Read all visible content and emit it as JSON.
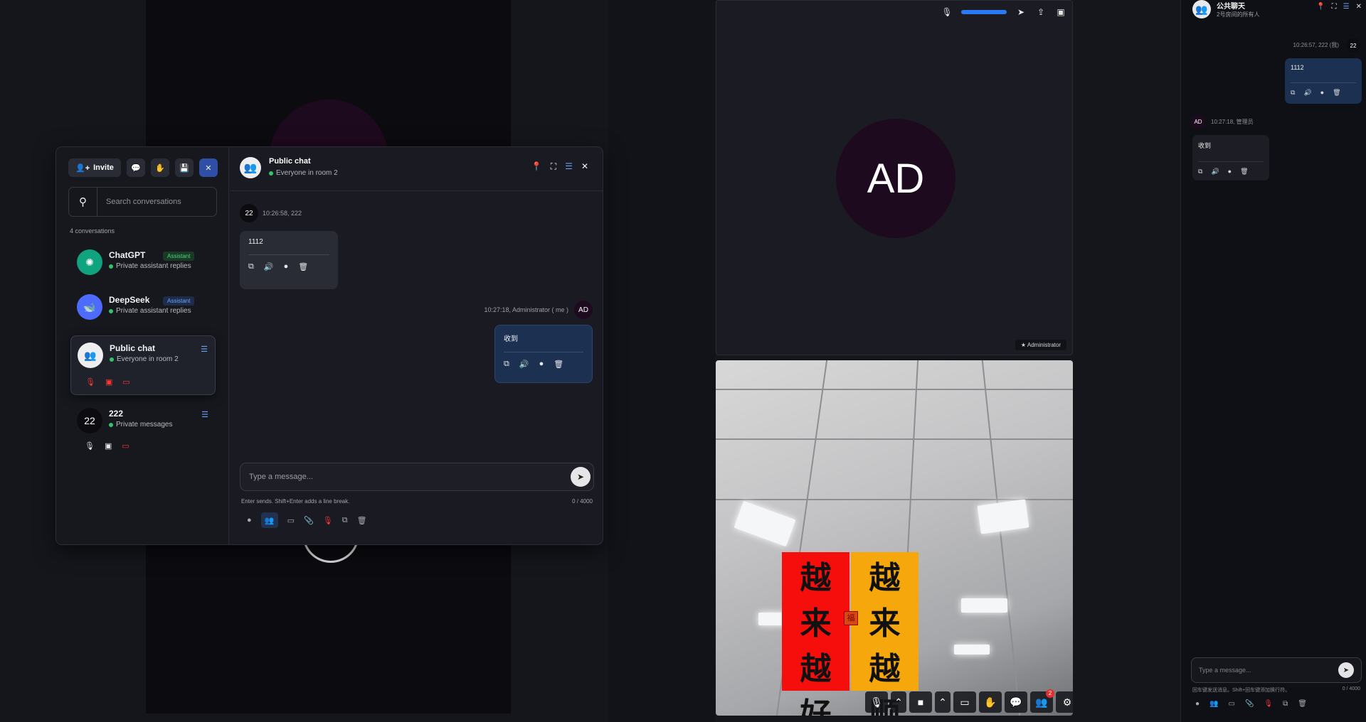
{
  "video_tiles": {
    "main_avatar_initials": "AD",
    "name_badge": "★ Administrator",
    "banner_left": [
      "越",
      "来",
      "越",
      "好"
    ],
    "banner_right": [
      "越",
      "来",
      "越",
      "顺"
    ],
    "seal_text": "福",
    "participants_badge": "2"
  },
  "side_panel": {
    "title": "公共聊天",
    "subtitle": "2号房间的所有人",
    "meta_right": "10:26:57, 222 (我)",
    "meta_right_avatar": "22",
    "bubble_right": "1112",
    "meta_left_avatar": "AD",
    "meta_left": "10:27:18, 管理员",
    "bubble_left": "收到",
    "input_placeholder": "Type a message...",
    "hint": "回车键发送消息。Shift+回车键添加换行符。",
    "count": "0 / 4000"
  },
  "sidebar": {
    "invite_label": "Invite",
    "search_placeholder": "Search conversations",
    "conversation_count": "4 conversations",
    "conversations": [
      {
        "name": "ChatGPT",
        "tag": "Assistant",
        "subtitle": "Private assistant replies"
      },
      {
        "name": "DeepSeek",
        "tag": "Assistant",
        "subtitle": "Private assistant replies"
      },
      {
        "name": "Public chat",
        "subtitle": "Everyone in room 2"
      },
      {
        "name": "222",
        "avatar": "22",
        "subtitle": "Private messages"
      }
    ]
  },
  "chat": {
    "title": "Public chat",
    "subtitle": "Everyone in room 2",
    "messages": [
      {
        "avatar": "22",
        "meta": "10:26:58, 222",
        "text": "1112"
      },
      {
        "avatar": "AD",
        "meta": "10:27:18, Administrator ( me )",
        "text": "收到"
      }
    ],
    "composer_placeholder": "Type a message...",
    "hint": "Enter sends. Shift+Enter adds a line break.",
    "char_count": "0 / 4000"
  },
  "colors": {
    "accent_blue": "#2f4fa6",
    "outgoing_bubble": "#1c3152",
    "online_green": "#35c26b",
    "muted_red": "#ff3636"
  },
  "icons": [
    "user-plus-icon",
    "chat-icon",
    "hand-icon",
    "save-icon",
    "close-icon",
    "search-icon",
    "pin-icon",
    "expand-icon",
    "menu-icon",
    "copy-icon",
    "speaker-icon",
    "emoji-icon",
    "trash-icon",
    "send-icon",
    "mic-off-icon",
    "video-off-icon",
    "screen-share-icon",
    "mic-icon",
    "video-icon",
    "attach-icon",
    "people-icon",
    "keyboard-icon",
    "phone-off-icon",
    "settings-icon"
  ]
}
